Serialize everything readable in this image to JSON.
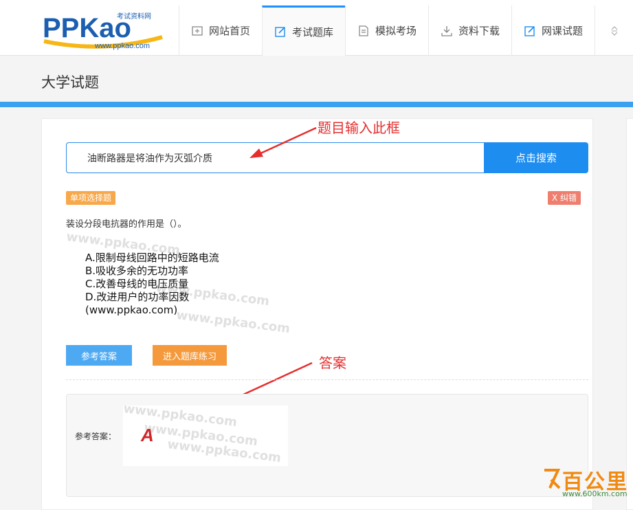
{
  "logo": {
    "brand_text": "PPKao",
    "tagline": "考试资料网",
    "url": "www.ppkao.com"
  },
  "nav": {
    "items": [
      {
        "label": "网站首页",
        "icon": "home-icon",
        "active": false
      },
      {
        "label": "考试题库",
        "icon": "edit-icon",
        "active": true
      },
      {
        "label": "模拟考场",
        "icon": "document-icon",
        "active": false
      },
      {
        "label": "资料下载",
        "icon": "download-icon",
        "active": false
      },
      {
        "label": "网课试题",
        "icon": "edit-icon",
        "active": false
      }
    ]
  },
  "page": {
    "title": "大学试题"
  },
  "search": {
    "query": "油断路器是将油作为灭弧介质",
    "button_label": "点击搜索"
  },
  "annotations": {
    "search_note": "题目输入此框",
    "answer_note": "答案"
  },
  "question": {
    "type_tag": "单项选择题",
    "report_tag": "X 纠错",
    "text": "装设分段电抗器的作用是（）。",
    "options": [
      "A.限制母线回路中的短路电流",
      "B.吸收多余的无功功率",
      "C.改善母线的电压质量",
      "D.改进用户的功率因数",
      "(www.ppkao.com)"
    ],
    "watermark": "www.ppkao.com"
  },
  "actions": {
    "answer_button": "参考答案",
    "practice_button": "进入题库练习"
  },
  "answer": {
    "label": "参考答案：",
    "value": "A"
  },
  "corner_logo": {
    "text": "百公里",
    "url": "www.600km.com"
  },
  "colors": {
    "accent": "#1e8df0",
    "nav_active": "#1e90ff",
    "tag_orange": "#f7a84a",
    "tag_red": "#ee7f6f",
    "annotation_red": "#e62d2d"
  }
}
